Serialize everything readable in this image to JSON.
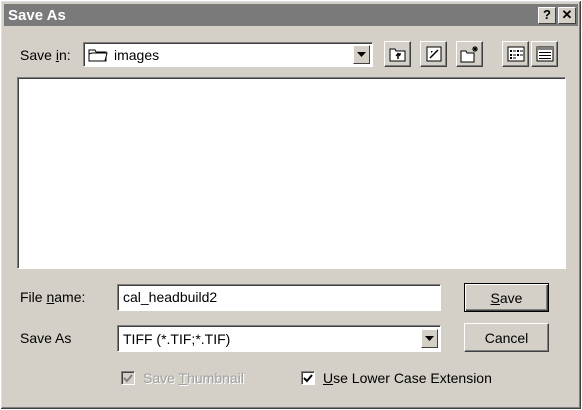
{
  "window": {
    "title": "Save As",
    "help_button": "?",
    "close_button": "✕"
  },
  "save_in": {
    "label_prefix": "Save ",
    "label_mnemonic": "i",
    "label_suffix": "n:",
    "folder_icon": "folder-icon",
    "value": "images"
  },
  "toolbar": {
    "buttons": [
      "up-one-level-icon",
      "desktop-icon",
      "create-new-folder-icon",
      "list-view-icon",
      "details-view-icon"
    ]
  },
  "file_name": {
    "label_prefix": "File ",
    "label_mnemonic": "n",
    "label_suffix": "ame:",
    "value": "cal_headbuild2"
  },
  "save_as_type": {
    "label": "Save As",
    "value": "TIFF (*.TIF;*.TIF)"
  },
  "buttons": {
    "save_mnemonic": "S",
    "save_suffix": "ave",
    "cancel": "Cancel"
  },
  "options": {
    "save_thumbnail": {
      "label_prefix": "Save ",
      "label_mnemonic": "T",
      "label_suffix": "humbnail",
      "checked": true,
      "enabled": false
    },
    "lower_case": {
      "label_mnemonic": "U",
      "label_suffix": "se Lower Case Extension",
      "checked": true,
      "enabled": true
    }
  },
  "colors": {
    "face": "#d4d0c8",
    "titlebar": "#7a7a7a",
    "disabled_text": "#a0a0a0"
  }
}
